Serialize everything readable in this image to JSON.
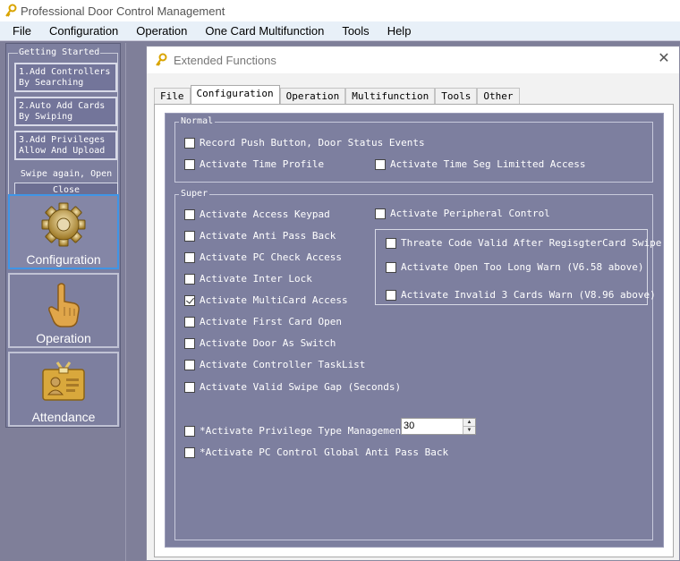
{
  "app": {
    "title": "Professional Door Control Management"
  },
  "menu": [
    "File",
    "Configuration",
    "Operation",
    "One Card Multifunction",
    "Tools",
    "Help"
  ],
  "sidebar": {
    "getting_started": {
      "legend": "Getting Started",
      "steps": [
        {
          "line1": "1.Add Controllers",
          "line2": "By Searching"
        },
        {
          "line1": "2.Auto Add Cards",
          "line2": "By Swiping"
        },
        {
          "line1": "3.Add Privileges",
          "line2": "Allow And Upload"
        }
      ],
      "hint": "Swipe again, Open",
      "close_label": "Close"
    },
    "nav": [
      {
        "label": "Configuration",
        "icon": "gear-icon",
        "active": true
      },
      {
        "label": "Operation",
        "icon": "hand-pointer-icon",
        "active": false
      },
      {
        "label": "Attendance",
        "icon": "id-badge-icon",
        "active": false
      }
    ]
  },
  "dialog": {
    "title": "Extended Functions",
    "tabs": [
      "File",
      "Configuration",
      "Operation",
      "Multifunction",
      "Tools",
      "Other"
    ],
    "active_tab": "Configuration",
    "normal": {
      "legend": "Normal",
      "items": [
        {
          "label": "Record Push Button, Door Status Events",
          "checked": false
        },
        {
          "label": "Activate Time Profile",
          "checked": false
        },
        {
          "label": "Activate Time Seg Limitted Access",
          "checked": false
        }
      ]
    },
    "super": {
      "legend": "Super",
      "left_items": [
        {
          "label": "Activate Access Keypad",
          "checked": false
        },
        {
          "label": "Activate Anti Pass Back",
          "checked": false
        },
        {
          "label": "Activate PC Check Access",
          "checked": false
        },
        {
          "label": "Activate Inter Lock",
          "checked": false
        },
        {
          "label": "Activate MultiCard Access",
          "checked": true
        },
        {
          "label": "Activate First Card Open",
          "checked": false
        },
        {
          "label": "Activate Door As Switch",
          "checked": false
        },
        {
          "label": "Activate Controller TaskList",
          "checked": false
        },
        {
          "label": "Activate Valid Swipe Gap (Seconds)",
          "checked": false
        }
      ],
      "peripheral": {
        "label": "Activate Peripheral Control",
        "checked": false
      },
      "peripheral_items": [
        {
          "label": "Threate Code Valid After RegisgterCard Swipe",
          "checked": false
        },
        {
          "label": "Activate Open Too Long Warn (V6.58 above)",
          "checked": false
        },
        {
          "label": "Activate Invalid 3 Cards  Warn (V8.96 above)",
          "checked": false
        }
      ],
      "privilege_type": {
        "label": "*Activate Privilege Type Management Mo",
        "checked": false
      },
      "privilege_value": "30",
      "global_apb": {
        "label": "*Activate PC Control Global Anti Pass Back",
        "checked": false
      }
    }
  }
}
